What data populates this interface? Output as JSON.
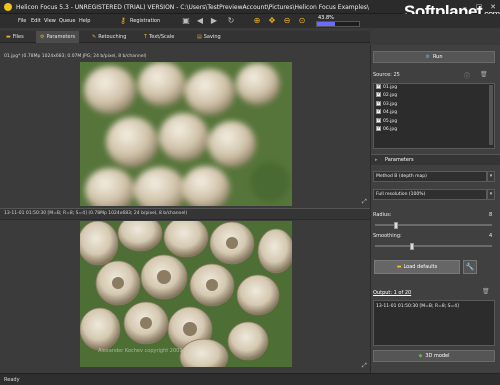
{
  "window": {
    "title": "Helicon Focus 5.3 - UNREGISTERED (TRIAL) VERSION - C:\\Users\\TestPreviewAccount\\Pictures\\Helicon Focus Examples\\",
    "controls": [
      "minimize-icon",
      "maximize-icon",
      "close-icon"
    ]
  },
  "watermark_logo": {
    "brand": "Softplanet",
    "domain": ".com"
  },
  "menu": [
    "File",
    "Edit",
    "View",
    "Queue",
    "Help"
  ],
  "toolbar": {
    "registration_label": "Registration",
    "icons": [
      "key-icon",
      "save-icon",
      "back-arrow-icon",
      "forward-arrow-icon",
      "refresh-icon",
      "zoom-in-icon",
      "move-icon",
      "zoom-out-icon",
      "zoom-fit-icon"
    ],
    "progress_text": "43.8%",
    "progress_value": 0.438
  },
  "tabs": [
    {
      "label": "Files",
      "active": false,
      "icon": "folder-icon"
    },
    {
      "label": "Parameters",
      "active": true,
      "icon": "gear-icon"
    },
    {
      "label": "Retouching",
      "active": false,
      "icon": "brush-icon"
    },
    {
      "label": "Text/Scale",
      "active": false,
      "icon": "text-scale-icon"
    },
    {
      "label": "Saving",
      "active": false,
      "icon": "disk-icon"
    }
  ],
  "top_pane": {
    "info": "01.jpg* (0.78Mp 1024x683; 0.07M JPG; 24 b/pixel, 8 b/channel)"
  },
  "bottom_pane": {
    "info": "13-11-01 01:50:30 [M=B; R=8; S=4] (0.78Mp 1024x683; 24 b/pixel, 8 b/channel)"
  },
  "image_watermark": "Alexander Kochev copyright 2009",
  "right_panel": {
    "run_label": "Run",
    "source_label": "Source: 25",
    "source_icons": [
      "info-icon",
      "trash-icon"
    ],
    "files": [
      "01.jpg",
      "02.jpg",
      "03.jpg",
      "04.jpg",
      "05.jpg",
      "06.jpg"
    ],
    "parameters_header": "Parameters",
    "method": "Method B (depth map)",
    "resolution": "Full resolution (100%)",
    "radius_label": "Radius:",
    "radius_value": "8",
    "radius_fraction": 0.18,
    "smoothing_label": "Smoothing:",
    "smoothing_value": "4",
    "smoothing_fraction": 0.32,
    "load_defaults_label": "Load defaults",
    "output_label": "Output: 1 of 20",
    "output_item": "13-11-01 01:50:30 [M=B; R=8; S=4]",
    "model_label": "3D model"
  },
  "status": {
    "text": "Ready"
  }
}
